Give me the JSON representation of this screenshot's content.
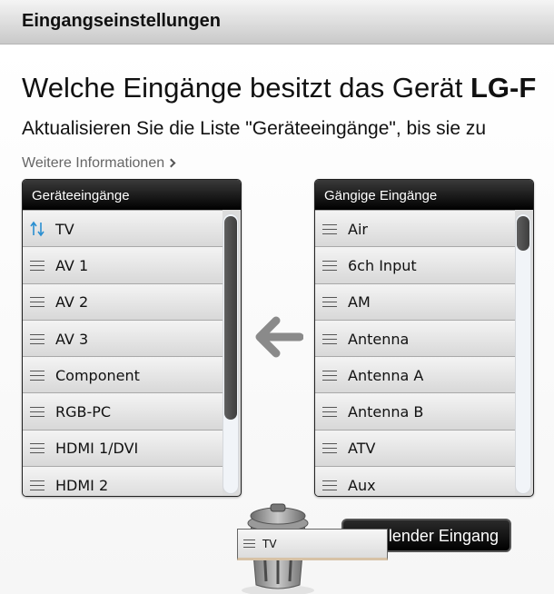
{
  "window": {
    "title": "Eingangseinstellungen"
  },
  "main": {
    "heading_prefix": "Welche Eingänge besitzt das Gerät ",
    "heading_device": "LG-F",
    "subheading": "Aktualisieren Sie die Liste \"Geräteeingänge\", bis sie zu",
    "more_info": "Weitere Informationen"
  },
  "device_inputs": {
    "title": "Geräteeingänge",
    "items": [
      {
        "label": "TV",
        "icon": "sort-arrows-icon"
      },
      {
        "label": "AV 1",
        "icon": "grip-icon"
      },
      {
        "label": "AV 2",
        "icon": "grip-icon"
      },
      {
        "label": "AV 3",
        "icon": "grip-icon"
      },
      {
        "label": "Component",
        "icon": "grip-icon"
      },
      {
        "label": "RGB-PC",
        "icon": "grip-icon"
      },
      {
        "label": "HDMI 1/DVI",
        "icon": "grip-icon"
      },
      {
        "label": "HDMI 2",
        "icon": "grip-icon"
      }
    ]
  },
  "common_inputs": {
    "title": "Gängige Eingänge",
    "items": [
      {
        "label": "Air"
      },
      {
        "label": "6ch Input"
      },
      {
        "label": "AM"
      },
      {
        "label": "Antenna"
      },
      {
        "label": "Antenna A"
      },
      {
        "label": "Antenna B"
      },
      {
        "label": "ATV"
      },
      {
        "label": "Aux"
      }
    ]
  },
  "actions": {
    "add_input": "Fehlender Eingang"
  },
  "drag": {
    "label": "TV"
  },
  "colors": {
    "accent": "#2a8fd1",
    "panel_header": "#000000"
  }
}
